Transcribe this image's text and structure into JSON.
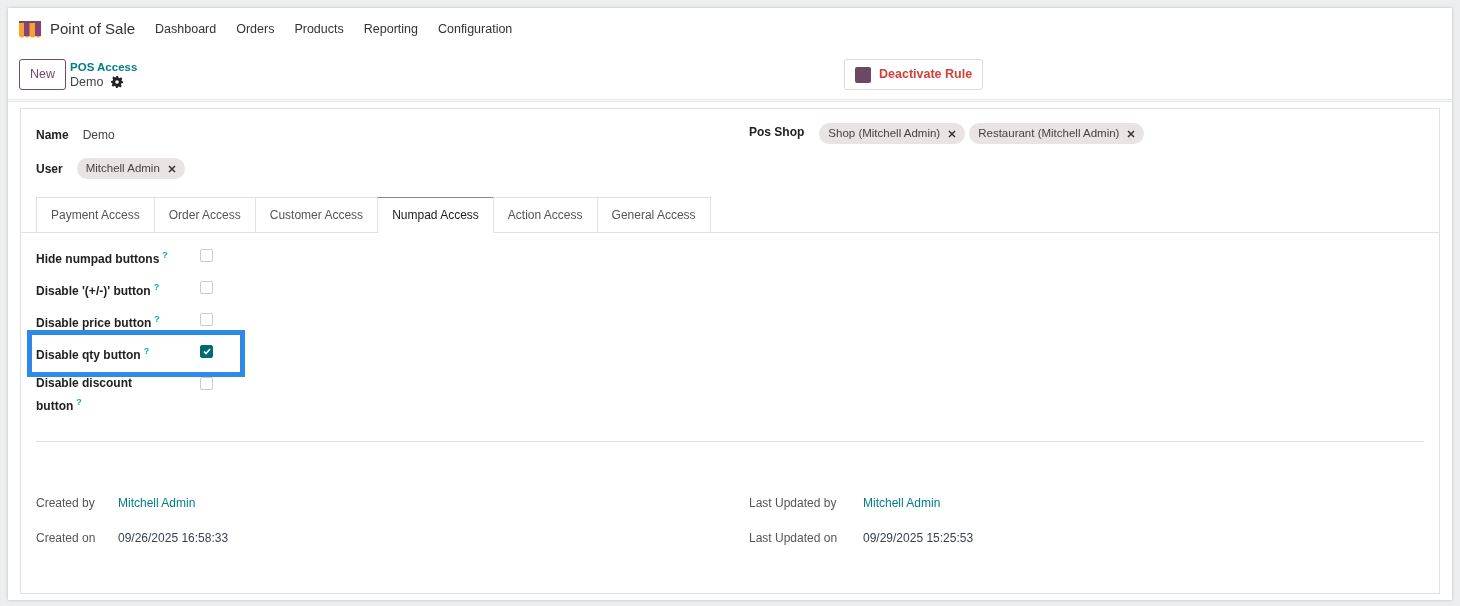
{
  "app": {
    "name": "Point of Sale",
    "menu": [
      "Dashboard",
      "Orders",
      "Products",
      "Reporting",
      "Configuration"
    ]
  },
  "control_panel": {
    "new_button": "New",
    "breadcrumb": "POS Access",
    "record": "Demo",
    "action_button": "Deactivate Rule"
  },
  "form": {
    "name_label": "Name",
    "name_value": "Demo",
    "user_label": "User",
    "users": [
      "Mitchell Admin"
    ],
    "shop_label": "Pos Shop",
    "shops": [
      "Shop (Mitchell Admin)",
      "Restaurant (Mitchell Admin)"
    ]
  },
  "tabs": [
    {
      "label": "Payment Access",
      "selected": false
    },
    {
      "label": "Order Access",
      "selected": false
    },
    {
      "label": "Customer Access",
      "selected": false
    },
    {
      "label": "Numpad Access",
      "selected": true
    },
    {
      "label": "Action Access",
      "selected": false
    },
    {
      "label": "General Access",
      "selected": false
    }
  ],
  "options": [
    {
      "label": "Hide numpad buttons",
      "help": "?",
      "checked": false,
      "highlighted": false
    },
    {
      "label": "Disable '(+/-)' button",
      "help": "?",
      "checked": false,
      "highlighted": false
    },
    {
      "label": "Disable price button",
      "help": "?",
      "checked": false,
      "highlighted": false
    },
    {
      "label": "Disable qty button",
      "help": "?",
      "checked": true,
      "highlighted": true
    },
    {
      "label": "Disable discount button",
      "help": "?",
      "checked": false,
      "highlighted": false
    }
  ],
  "audit": {
    "created_by_label": "Created by",
    "created_by": "Mitchell Admin",
    "created_on_label": "Created on",
    "created_on": "09/26/2025 16:58:33",
    "updated_by_label": "Last Updated by",
    "updated_by": "Mitchell Admin",
    "updated_on_label": "Last Updated on",
    "updated_on": "09/29/2025 15:25:53"
  }
}
